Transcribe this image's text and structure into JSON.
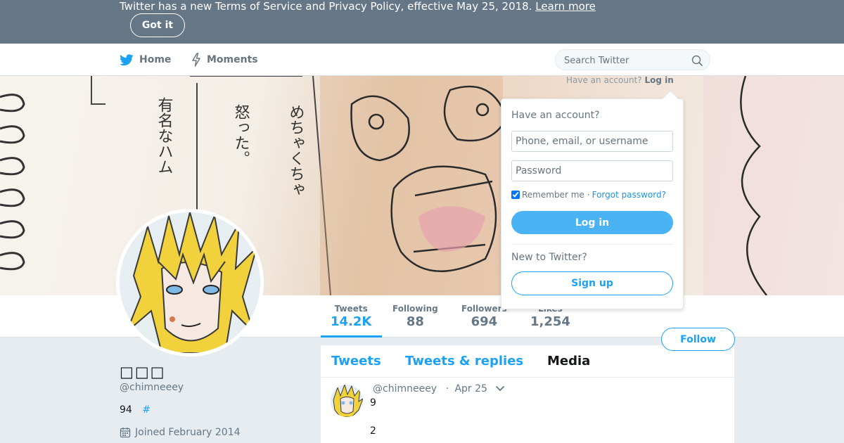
{
  "banner": {
    "text": "Twitter has a new Terms of Service and Privacy Policy, effective May 25, 2018.",
    "link_label": "Learn more",
    "dismiss_label": "Got it"
  },
  "nav": {
    "home_label": "Home",
    "moments_label": "Moments",
    "search_placeholder": "Search Twitter",
    "have_account_text": "Have an account?",
    "login_link": "Log in"
  },
  "login_dropdown": {
    "title": "Have an account?",
    "username_placeholder": "Phone, email, or username",
    "password_placeholder": "Password",
    "remember_label": "Remember me",
    "separator": "·",
    "forgot_label": "Forgot password?",
    "login_button": "Log in",
    "new_user_text": "New to Twitter?",
    "signup_button": "Sign up"
  },
  "header_image": {
    "jp_text_1": "めちゃくちゃ",
    "jp_text_2": "怒った。",
    "jp_text_3": "有名なハム"
  },
  "stats": [
    {
      "label": "Tweets",
      "value": "14.2K"
    },
    {
      "label": "Following",
      "value": "88"
    },
    {
      "label": "Followers",
      "value": "694"
    },
    {
      "label": "Likes",
      "value": "1,254"
    }
  ],
  "follow_button": "Follow",
  "profile": {
    "name": "□□□",
    "handle": "@chimneeey",
    "bio_text": "94",
    "bio_hash": "#",
    "joined": "Joined February 2014"
  },
  "timeline": {
    "tabs": [
      "Tweets",
      "Tweets & replies",
      "Media"
    ],
    "tweet": {
      "handle": "@chimneeey",
      "separator": "·",
      "date": "Apr 25",
      "line1": "9",
      "line2": "2"
    }
  },
  "colors": {
    "accent": "#1da1f2",
    "banner_bg": "#657786",
    "page_bg": "#e6ecf0",
    "login_button_bg": "#4ab3f4"
  },
  "icons": {
    "home": "twitter-bird-icon",
    "moments": "lightning-icon",
    "search": "search-icon",
    "calendar": "calendar-icon",
    "caret": "chevron-down-icon"
  }
}
